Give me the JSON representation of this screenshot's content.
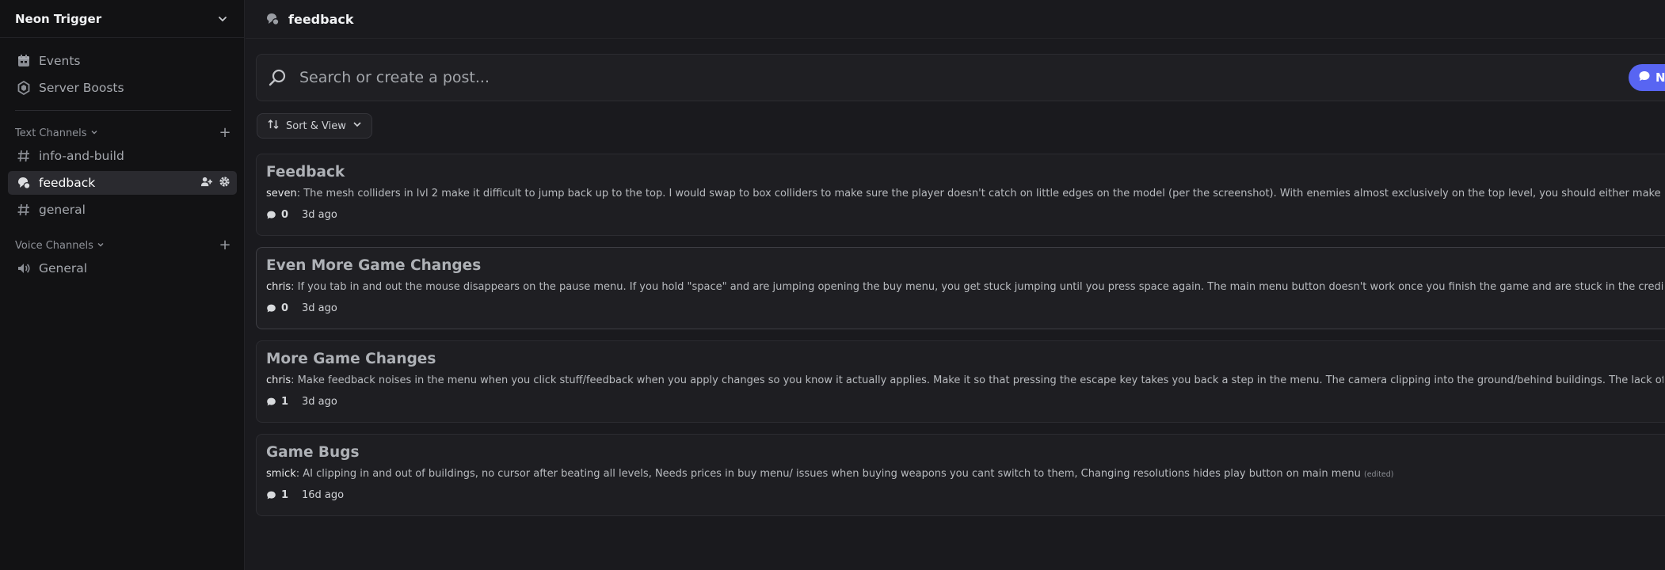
{
  "server": {
    "name": "Neon Trigger"
  },
  "sidebar": {
    "top_items": [
      {
        "label": "Events",
        "icon": "calendar-icon"
      },
      {
        "label": "Server Boosts",
        "icon": "boost-icon"
      }
    ],
    "text_category": "Text Channels",
    "text_channels": [
      {
        "label": "info-and-build",
        "icon": "hash-icon"
      },
      {
        "label": "feedback",
        "icon": "forum-icon",
        "active": true
      },
      {
        "label": "general",
        "icon": "hash-icon"
      }
    ],
    "voice_category": "Voice Channels",
    "voice_channels": [
      {
        "label": "General",
        "icon": "speaker-icon"
      }
    ]
  },
  "topbar": {
    "title": "feedback"
  },
  "search": {
    "placeholder": "Search or create a post..."
  },
  "new_button": {
    "label": "N"
  },
  "sort": {
    "label": "Sort & View"
  },
  "posts": [
    {
      "title": "Feedback",
      "author": "seven",
      "preview": "The mesh colliders in lvl 2 make it difficult to jump back up to the top. I would swap to box colliders to make sure the player doesn't catch on little edges on the model (per the screenshot). With enemies almost exclusively on the top level, you should either make the path back up to the t...",
      "comments": "0",
      "ago": "3d ago"
    },
    {
      "title": "Even More Game Changes",
      "author": "chris",
      "preview": "If you tab in and out the mouse disappears on the pause menu. If you hold \"space\" and are jumping opening the buy menu, you get stuck jumping until you press space again. The main menu button doesn't work once you finish the game and are stuck in the credits screen.",
      "comments": "0",
      "ago": "3d ago"
    },
    {
      "title": "More Game Changes",
      "author": "chris",
      "preview": "Make feedback noises in the menu when you click stuff/feedback when you apply changes so you know it actually applies. Make it so that pressing the escape key takes you back a step in the menu. The camera clipping into the ground/behind buildings. The lack of ambient sounds and foots",
      "comments": "1",
      "ago": "3d ago"
    },
    {
      "title": "Game Bugs",
      "author": "smick",
      "preview": "AI clipping in and out of buildings, no cursor after beating all levels, Needs prices in buy menu/ issues when buying weapons you cant switch to them, Changing resolutions hides play button on main menu",
      "edited": "(edited)",
      "comments": "1",
      "ago": "16d ago"
    }
  ],
  "colors": {
    "accent": "#5865f2",
    "sidebar_bg": "#121214",
    "main_bg": "#1a1a1e"
  }
}
